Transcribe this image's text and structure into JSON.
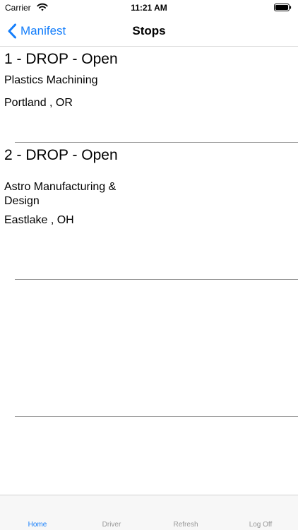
{
  "status_bar": {
    "carrier": "Carrier",
    "time": "11:21 AM"
  },
  "nav": {
    "back_label": "Manifest",
    "title": "Stops"
  },
  "stops": [
    {
      "header": "1  -  DROP  -  Open",
      "company": "Plastics Machining",
      "location": "Portland ,  OR"
    },
    {
      "header": "2  -  DROP  -  Open",
      "company": "Astro Manufacturing & Design",
      "location": "Eastlake ,  OH"
    }
  ],
  "tab_bar": {
    "tabs": [
      {
        "label": "Home",
        "active": true
      },
      {
        "label": "Driver",
        "active": false
      },
      {
        "label": "Refresh",
        "active": false
      },
      {
        "label": "Log Off",
        "active": false
      }
    ]
  },
  "colors": {
    "accent": "#147efb",
    "inactive_tab": "#999999"
  }
}
